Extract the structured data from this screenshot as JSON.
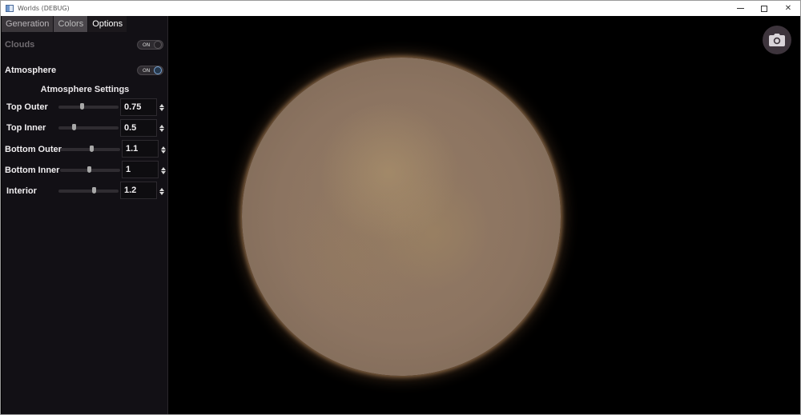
{
  "window": {
    "title": "Worlds (DEBUG)"
  },
  "tabs": [
    {
      "label": "Generation"
    },
    {
      "label": "Colors"
    },
    {
      "label": "Options"
    }
  ],
  "options": {
    "clouds": {
      "label": "Clouds",
      "toggle_text": "ON",
      "enabled": true,
      "dimmed": true
    },
    "atmosphere": {
      "label": "Atmosphere",
      "toggle_text": "ON",
      "enabled": true
    },
    "section_title": "Atmosphere Settings",
    "sliders": [
      {
        "label": "Top Outer",
        "value": "0.75",
        "fraction": 0.38
      },
      {
        "label": "Top Inner",
        "value": "0.5",
        "fraction": 0.25
      },
      {
        "label": "Bottom Outer",
        "value": "1.1",
        "fraction": 0.52
      },
      {
        "label": "Bottom Inner",
        "value": "1",
        "fraction": 0.48
      },
      {
        "label": "Interior",
        "value": "1.2",
        "fraction": 0.58
      }
    ]
  },
  "colors": {
    "panel": "#121015",
    "active_tab": "#1b181c",
    "planet": "#8c7461",
    "glow": "#b5895c",
    "camera_button": "#3d343c"
  },
  "icons": {
    "camera": "camera-icon",
    "minimize": "minimize-icon",
    "maximize": "maximize-icon",
    "close": "close-icon"
  }
}
